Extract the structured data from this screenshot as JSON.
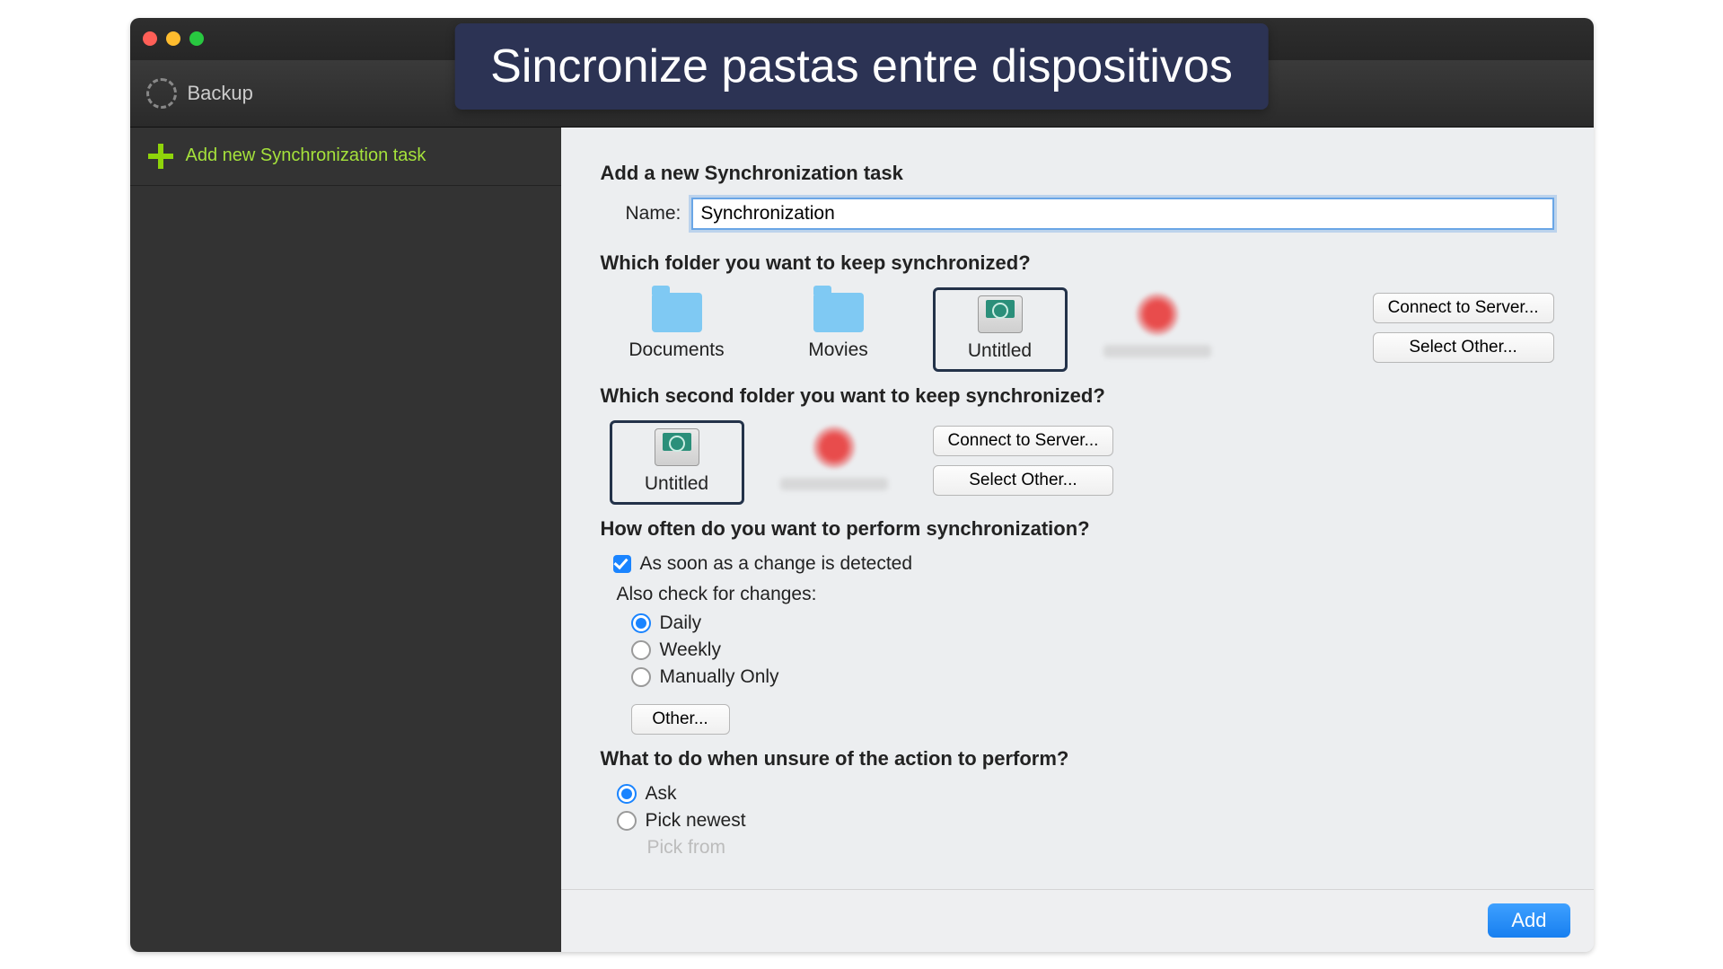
{
  "banner": "Sincronize pastas entre dispositivos",
  "toolbar": {
    "title": "Backup"
  },
  "sidebar": {
    "add_task": "Add new Synchronization task"
  },
  "form": {
    "heading": "Add a new Synchronization task",
    "name_label": "Name:",
    "name_value": "Synchronization",
    "q_folder1": "Which folder you want to keep synchronized?",
    "folders1": {
      "documents": "Documents",
      "movies": "Movies",
      "untitled": "Untitled"
    },
    "connect_server": "Connect to Server...",
    "select_other": "Select Other...",
    "q_folder2": "Which second folder you want to keep synchronized?",
    "folders2": {
      "untitled": "Untitled"
    },
    "q_freq": "How often do you want to perform synchronization?",
    "freq_change": "As soon as a change is detected",
    "also_check": "Also check for changes:",
    "freq_options": {
      "daily": "Daily",
      "weekly": "Weekly",
      "manual": "Manually Only"
    },
    "other_btn": "Other...",
    "q_unsure": "What to do when unsure of the action to perform?",
    "unsure_options": {
      "ask": "Ask",
      "newest": "Pick newest",
      "from": "Pick from"
    }
  },
  "footer": {
    "add": "Add"
  }
}
